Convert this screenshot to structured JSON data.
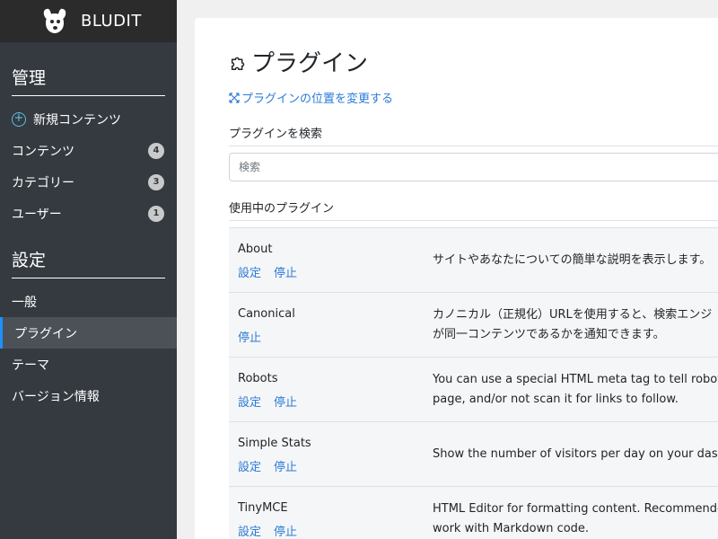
{
  "brand": {
    "name": "BLUDIT",
    "logo_icon": "dog-logo-icon"
  },
  "sidebar": {
    "manage_title": "管理",
    "manage_items": [
      {
        "label": "新規コンテンツ",
        "icon": "plus-circle-icon"
      },
      {
        "label": "コンテンツ",
        "badge": "4"
      },
      {
        "label": "カテゴリー",
        "badge": "3"
      },
      {
        "label": "ユーザー",
        "badge": "1"
      }
    ],
    "settings_title": "設定",
    "settings_items": [
      {
        "label": "一般"
      },
      {
        "label": "プラグイン",
        "active": true
      },
      {
        "label": "テーマ"
      },
      {
        "label": "バージョン情報"
      }
    ]
  },
  "main": {
    "title": "プラグイン",
    "title_icon": "puzzle-icon",
    "reorder_link": "プラグインの位置を変更する",
    "search_label": "プラグインを検索",
    "search_placeholder": "検索",
    "enabled_label": "使用中のプラグイン",
    "plugins": [
      {
        "name": "About",
        "settings": "設定",
        "disable": "停止",
        "desc1": "サイトやあなたについての簡単な説明を表示します。",
        "desc2": ""
      },
      {
        "name": "Canonical",
        "settings": "",
        "disable": "停止",
        "desc1": "カノニカル（正規化）URLを使用すると、検索エンジ",
        "desc2": "が同一コンテンツであるかを通知できます。"
      },
      {
        "name": "Robots",
        "settings": "設定",
        "disable": "停止",
        "desc1": "You can use a special HTML meta tag to tell robots no",
        "desc2": "page, and/or not scan it for links to follow."
      },
      {
        "name": "Simple Stats",
        "settings": "設定",
        "disable": "停止",
        "desc1": "Show the number of visitors per day on your dashbo",
        "desc2": ""
      },
      {
        "name": "TinyMCE",
        "settings": "設定",
        "disable": "停止",
        "desc1": "HTML Editor for formatting content. Recommended fo",
        "desc2": "work with Markdown code."
      }
    ]
  },
  "colors": {
    "sidebar_bg": "#343a40",
    "brand_bg": "#2b2b2b",
    "link": "#2b7bd8",
    "active_bar": "#1e90ff",
    "plus_icon": "#5bc0de"
  }
}
